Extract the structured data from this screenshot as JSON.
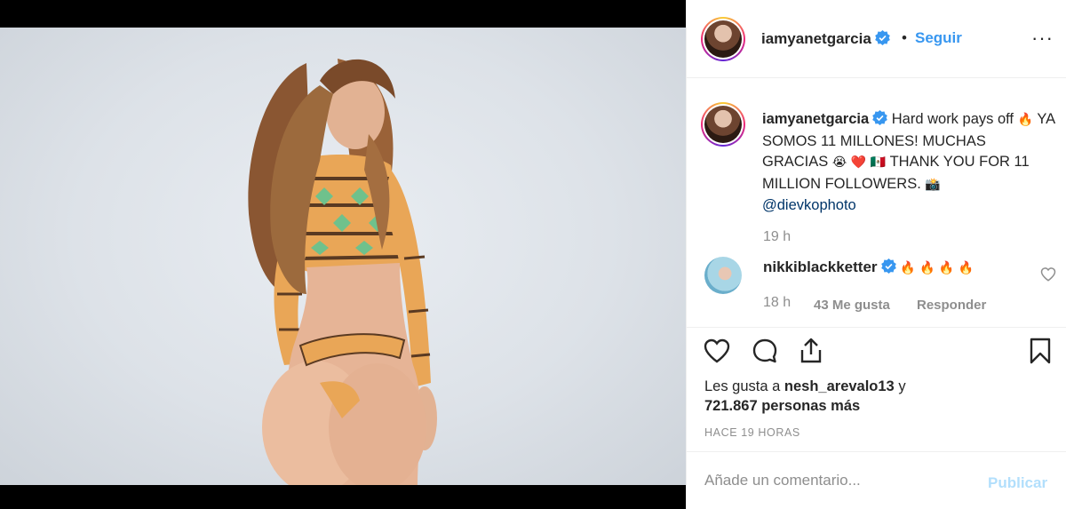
{
  "post": {
    "author": "iamyanetgarcia",
    "follow_label": "Seguir",
    "separator": "•",
    "more_label": "···",
    "caption": {
      "username": "iamyanetgarcia",
      "part1": "Hard work pays off",
      "emoji_fire": "🔥",
      "part2": "YA SOMOS 11 MILLONES! MUCHAS GRACIAS",
      "emoji_cry": "😭",
      "emoji_heart": "❤️",
      "emoji_flag": "🇲🇽",
      "part3": "THANK YOU FOR 11 MILLION FOLLOWERS.",
      "emoji_camera": "📸",
      "mention": "@dievkophoto",
      "time": "19 h"
    },
    "reply": {
      "username": "nikkiblackketter",
      "emojis": "🔥 🔥 🔥 🔥",
      "time": "18 h",
      "likes": "43 Me gusta",
      "reply_label": "Responder"
    },
    "likes": {
      "prefix": "Les gusta a",
      "user": "nesh_arevalo13",
      "suffix": "y",
      "count_line": "721.867 personas más"
    },
    "time_ago": "HACE 19 HORAS",
    "comment": {
      "placeholder": "Añade un comentario...",
      "publish_label": "Publicar"
    }
  },
  "icons": {
    "like": "heart-outline-icon",
    "comment": "comment-bubble-icon",
    "share": "share-icon",
    "save": "bookmark-icon",
    "verified": "verified-badge-icon"
  },
  "colors": {
    "accent": "#3897f0",
    "verified": "#3897f0",
    "muted": "#8e8e8e",
    "publish_disabled": "#b2dffc"
  }
}
